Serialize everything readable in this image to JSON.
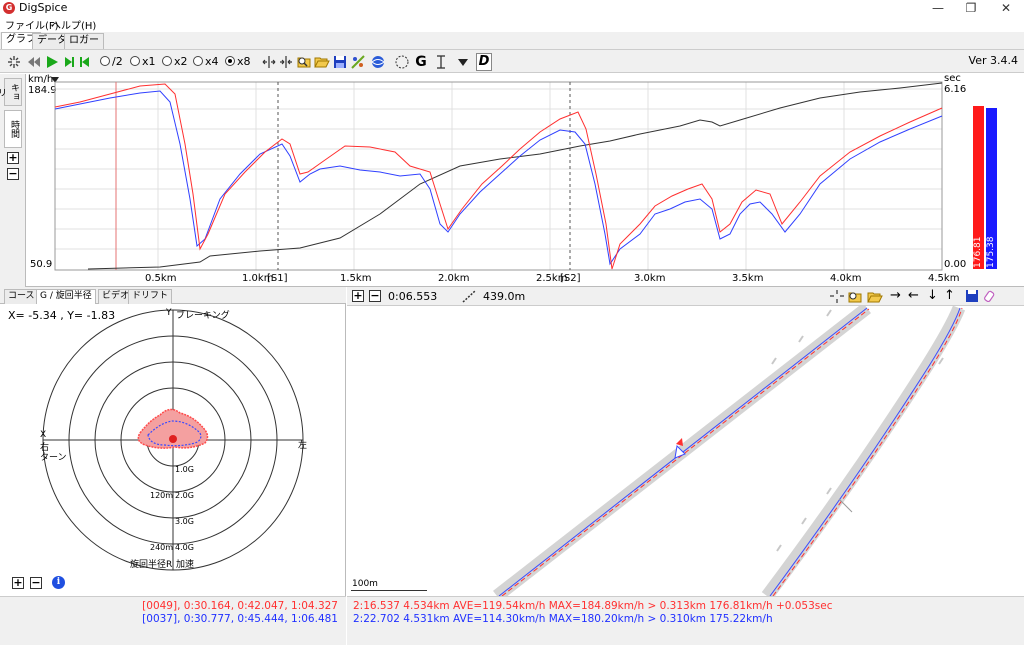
{
  "window": {
    "title": "DigSpice",
    "app_icon": "G"
  },
  "menu": [
    "ファイル(F)",
    "ヘルプ(H)"
  ],
  "main_tabs": [
    "グラフ",
    "データ",
    "ロガー"
  ],
  "toolbar": {
    "speed_options": [
      "/2",
      "x1",
      "x2",
      "x4",
      "x8"
    ],
    "selected_speed": "x8",
    "g_label": "G",
    "d_label": "D",
    "version": "Ver 3.4.4"
  },
  "graph": {
    "side_tabs": [
      "キョリ",
      "時間"
    ],
    "left_unit": "km/h",
    "left_max": "184.9",
    "left_min": "50.9",
    "right_unit": "sec",
    "right_max": "6.16",
    "right_min": "0.00",
    "x_ticks": [
      "0.5km",
      "1.0km",
      "[S1]",
      "1.5km",
      "2.0km",
      "2.5km",
      "[S2]",
      "3.0km",
      "3.5km",
      "4.0km",
      "4.5km"
    ],
    "bar_red_value": "176.81",
    "bar_blue_value": "175.38",
    "bar_red_fraction": 0.93,
    "bar_blue_fraction": 0.92,
    "colors": {
      "red": "#ff3030",
      "blue": "#3040ff",
      "dark": "#333333"
    }
  },
  "left_panel": {
    "tabs": [
      "コース",
      "G / 旋回半径",
      "ビデオ",
      "ドリフト"
    ],
    "active_tab": "G / 旋回半径",
    "xy_readout": "X= -5.34 , Y= -1.83",
    "y_axis_label": "Y",
    "braking_label": "ブレーキング",
    "x_axis_label": "X",
    "left_label": "右",
    "turn_label": "ターン",
    "right_label": "左",
    "g_rings": [
      "1.0G",
      "2.0G",
      "3.0G",
      "4.0G"
    ],
    "radius_rings": [
      "120m",
      "240m"
    ],
    "bottom_label": "旋回半径R",
    "accel_label": "加速"
  },
  "right_panel": {
    "time_readout": "0:06.553",
    "distance_readout": "439.0m",
    "scale_label": "100m"
  },
  "status": {
    "left_red": "[0049], 0:30.164, 0:42.047, 1:04.327",
    "left_blue": "[0037], 0:30.777, 0:45.444, 1:06.481",
    "right_red": "2:16.537 4.534km AVE=119.54km/h MAX=184.89km/h > 0.313km 176.81km/h +0.053sec",
    "right_blue": "2:22.702 4.531km AVE=114.30km/h MAX=180.20km/h > 0.310km 175.22km/h"
  }
}
